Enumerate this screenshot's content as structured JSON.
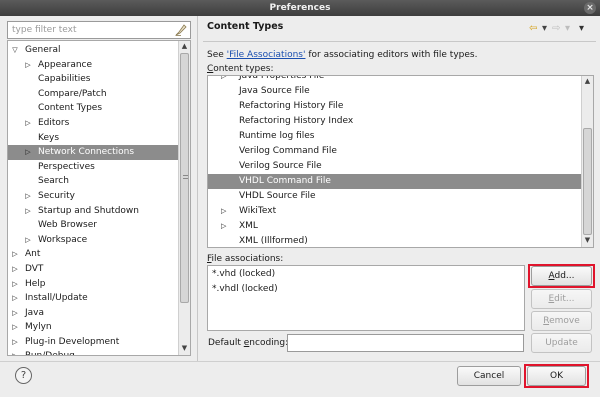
{
  "window": {
    "title": "Preferences",
    "close_glyph": "×"
  },
  "filter": {
    "placeholder": "type filter text",
    "value": "",
    "clear_icon": "clear-filter-icon"
  },
  "tree": {
    "selected_index": 7,
    "items": [
      {
        "label": "General",
        "level": 0,
        "toggle": "expanded"
      },
      {
        "label": "Appearance",
        "level": 1,
        "toggle": "collapsed"
      },
      {
        "label": "Capabilities",
        "level": 1,
        "toggle": "none"
      },
      {
        "label": "Compare/Patch",
        "level": 1,
        "toggle": "none"
      },
      {
        "label": "Content Types",
        "level": 1,
        "toggle": "none"
      },
      {
        "label": "Editors",
        "level": 1,
        "toggle": "collapsed"
      },
      {
        "label": "Keys",
        "level": 1,
        "toggle": "none"
      },
      {
        "label": "Network Connections",
        "level": 1,
        "toggle": "collapsed"
      },
      {
        "label": "Perspectives",
        "level": 1,
        "toggle": "none"
      },
      {
        "label": "Search",
        "level": 1,
        "toggle": "none"
      },
      {
        "label": "Security",
        "level": 1,
        "toggle": "collapsed"
      },
      {
        "label": "Startup and Shutdown",
        "level": 1,
        "toggle": "collapsed"
      },
      {
        "label": "Web Browser",
        "level": 1,
        "toggle": "none"
      },
      {
        "label": "Workspace",
        "level": 1,
        "toggle": "collapsed"
      },
      {
        "label": "Ant",
        "level": 0,
        "toggle": "collapsed"
      },
      {
        "label": "DVT",
        "level": 0,
        "toggle": "collapsed"
      },
      {
        "label": "Help",
        "level": 0,
        "toggle": "collapsed"
      },
      {
        "label": "Install/Update",
        "level": 0,
        "toggle": "collapsed"
      },
      {
        "label": "Java",
        "level": 0,
        "toggle": "collapsed"
      },
      {
        "label": "Mylyn",
        "level": 0,
        "toggle": "collapsed"
      },
      {
        "label": "Plug-in Development",
        "level": 0,
        "toggle": "collapsed"
      },
      {
        "label": "Run/Debug",
        "level": 0,
        "toggle": "collapsed"
      }
    ]
  },
  "page": {
    "title": "Content Types",
    "nav": {
      "back_glyph": "⇦",
      "forward_glyph": "⇨",
      "menu_glyph": "▾"
    },
    "description_prefix": "See ",
    "description_link": "'File Associations'",
    "description_suffix": " for associating editors with file types.",
    "content_types_label_mnemonic": "C",
    "content_types_label_rest": "ontent types:",
    "content_types_selected_index": 7,
    "content_types": [
      {
        "label": "Java Properties File",
        "toggle": "collapsed"
      },
      {
        "label": "Java Source File",
        "toggle": "none"
      },
      {
        "label": "Refactoring History File",
        "toggle": "none"
      },
      {
        "label": "Refactoring History Index",
        "toggle": "none"
      },
      {
        "label": "Runtime log files",
        "toggle": "none"
      },
      {
        "label": "Verilog Command File",
        "toggle": "none"
      },
      {
        "label": "Verilog Source File",
        "toggle": "none"
      },
      {
        "label": "VHDL Command File",
        "toggle": "none"
      },
      {
        "label": "VHDL Source File",
        "toggle": "none"
      },
      {
        "label": "WikiText",
        "toggle": "collapsed"
      },
      {
        "label": "XML",
        "toggle": "collapsed"
      },
      {
        "label": "XML (Illformed)",
        "toggle": "none"
      }
    ],
    "file_assoc_label_mnemonic": "F",
    "file_assoc_label_rest": "ile associations:",
    "file_associations": [
      "*.vhd (locked)",
      "*.vhdl (locked)"
    ],
    "buttons": {
      "add_mnemonic": "A",
      "add_rest": "dd...",
      "edit_mnemonic": "E",
      "edit_rest": "dit...",
      "remove_mnemonic": "R",
      "remove_rest": "emove",
      "update_label": "Update"
    },
    "encoding_label_pre": "Default ",
    "encoding_label_mnemonic": "e",
    "encoding_label_rest": "ncoding:",
    "encoding_value": ""
  },
  "footer": {
    "help_glyph": "?",
    "cancel_label": "Cancel",
    "ok_label": "OK"
  },
  "colors": {
    "selection": "#8c8c8c",
    "highlight": "#e0142c",
    "link": "#1a4fb0"
  }
}
